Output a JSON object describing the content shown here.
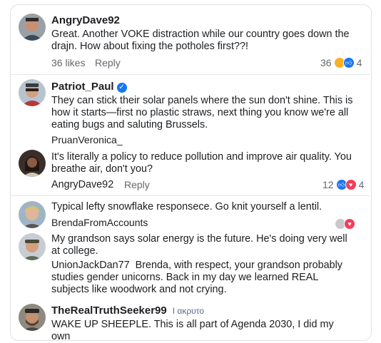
{
  "comments": [
    {
      "author": "AngryDave92",
      "text": "Great. Another VOKE distraction while our country goes down the drajn. How about fixing the potholes first??!",
      "likes": "36 likes",
      "reply": "Reply",
      "count": "36",
      "count2": "4"
    },
    {
      "author": "Patriot_Paul",
      "text": "They can stick their solar panels where the sun don't shine. This is how it starts—first no plastic straws, next thing you know we're all eating bugs and saluting Brussels."
    },
    {
      "author": "PruanVeronica_",
      "text": "It's literally a policy to reduce pollution and improve air quality. You breathe air, don't you?"
    },
    {
      "author": "AngryDave92",
      "reply": "Reply",
      "count": "12",
      "count2": "4"
    },
    {
      "text": "Typical lefty snowflake responsece. Go knit yourself a lentil."
    },
    {
      "author": "BrendaFromAccounts",
      "text": "My grandson says solar energy is the future. He's doing very well at college."
    },
    {
      "author": "UnionJackDan77",
      "text": "Brenda, with respect, your grandson probably studies gender unicorns. Back in my day we learned REAL subjects like woodwork and not crying."
    },
    {
      "author": "TheRealTruthSeeker99",
      "tag": "I ακρυτο",
      "text": "WAKE UP SHEEPLE. This is all part of Agenda 2030, I did my own"
    }
  ],
  "verified_mark": "✓",
  "colors": {
    "accent": "#1877f2",
    "love": "#f33e58",
    "haha": "#f7b125"
  }
}
